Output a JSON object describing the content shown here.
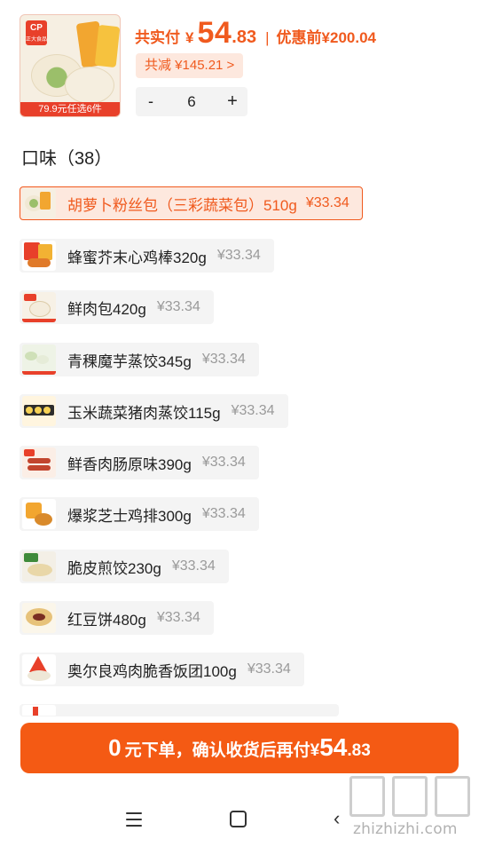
{
  "product": {
    "image_caption": "79.9元任选6件",
    "logo_text": "CP",
    "logo_subtext": "正大食品"
  },
  "price": {
    "paid_label": "共实付",
    "currency": "¥",
    "paid_int": "54",
    "paid_dec": ".83",
    "separator": "|",
    "original_label": "优惠前",
    "original_value": "¥200.04",
    "discount_text": "共减 ¥145.21 >"
  },
  "stepper": {
    "minus": "-",
    "quantity": "6",
    "plus": "+"
  },
  "flavor": {
    "title": "口味（38）",
    "options": [
      {
        "name": "胡萝卜粉丝包（三彩蔬菜包）510g",
        "price": "¥33.34",
        "selected": true,
        "icon": "veggie-bun-icon"
      },
      {
        "name": "蜂蜜芥末心鸡棒320g",
        "price": "¥33.34",
        "selected": false,
        "icon": "chicken-stick-icon"
      },
      {
        "name": "鲜肉包420g",
        "price": "¥33.34",
        "selected": false,
        "icon": "meat-bun-icon"
      },
      {
        "name": "青稞魔芋蒸饺345g",
        "price": "¥33.34",
        "selected": false,
        "icon": "steamed-dumpling-icon"
      },
      {
        "name": "玉米蔬菜猪肉蒸饺115g",
        "price": "¥33.34",
        "selected": false,
        "icon": "corn-dumpling-icon"
      },
      {
        "name": "鲜香肉肠原味390g",
        "price": "¥33.34",
        "selected": false,
        "icon": "sausage-icon"
      },
      {
        "name": "爆浆芝士鸡排300g",
        "price": "¥33.34",
        "selected": false,
        "icon": "chicken-cutlet-icon"
      },
      {
        "name": "脆皮煎饺230g",
        "price": "¥33.34",
        "selected": false,
        "icon": "fried-dumpling-icon"
      },
      {
        "name": "红豆饼480g",
        "price": "¥33.34",
        "selected": false,
        "icon": "red-bean-cake-icon"
      },
      {
        "name": "奥尔良鸡肉脆香饭团100g",
        "price": "¥33.34",
        "selected": false,
        "icon": "rice-ball-icon"
      }
    ]
  },
  "cta": {
    "zero": "0",
    "text": "元下单，确认收货后再付",
    "currency": "¥",
    "amount_int": "54",
    "amount_dec": ".83"
  },
  "navbar": {
    "menu_icon": "menu-icon",
    "home_icon": "home-icon",
    "back_icon": "back-icon"
  },
  "watermark": {
    "text": "zhizhizhi.com"
  },
  "colors": {
    "accent": "#f05a1e",
    "cta": "#f45a14",
    "chip_bg": "#fde8de",
    "option_bg": "#f4f4f4",
    "muted_price": "#9a9a9a"
  }
}
